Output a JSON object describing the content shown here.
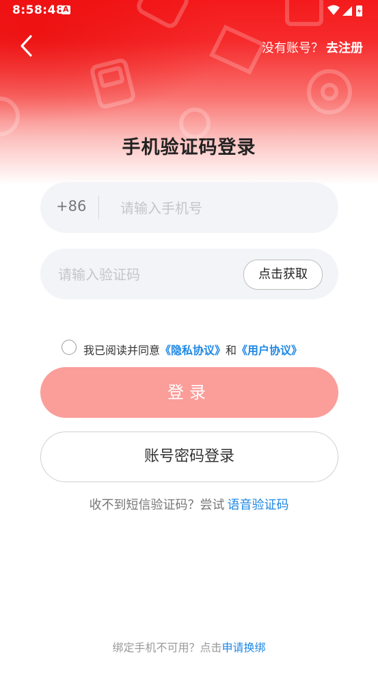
{
  "status_bar": {
    "time": "8:58:48",
    "notification_glyph": "A",
    "icons": [
      "wifi-icon",
      "signal-icon",
      "battery-charging-icon"
    ]
  },
  "nav": {
    "back_icon": "chevron-left-icon",
    "register_question": "没有账号？",
    "register_link": "去注册"
  },
  "title": "手机验证码登录",
  "phone_field": {
    "country_code": "+86",
    "placeholder": "请输入手机号",
    "value": ""
  },
  "code_field": {
    "placeholder": "请输入验证码",
    "value": "",
    "get_code_label": "点击获取"
  },
  "agreement": {
    "checked": false,
    "prefix": "我已阅读并同意",
    "privacy_link": "《隐私协议》",
    "and": "和",
    "user_link": "《用户协议》"
  },
  "login_button": "登录",
  "password_login_button": "账号密码登录",
  "sms_help": {
    "text": "收不到短信验证码？尝试",
    "link": "语音验证码"
  },
  "bottom_help": {
    "text": "绑定手机不可用？点击",
    "link": "申请换绑"
  },
  "colors": {
    "brand_red": "#f41a1c",
    "login_button": "#fb9d99",
    "link_blue": "#1e88e5"
  }
}
